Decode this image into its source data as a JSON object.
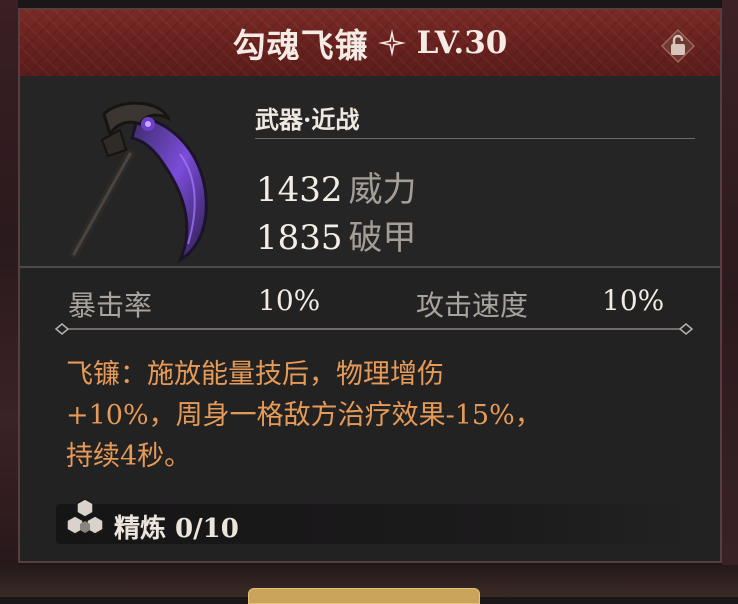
{
  "item": {
    "name": "勾魂飞镰",
    "level": "LV.30",
    "category": "武器·近战"
  },
  "stats": [
    {
      "value": "1432",
      "name": "威力"
    },
    {
      "value": "1835",
      "name": "破甲"
    }
  ],
  "secondary": [
    {
      "label": "暴击率",
      "value": "10%"
    },
    {
      "label": "攻击速度",
      "value": "10%"
    }
  ],
  "description": {
    "line1": "飞镰：施放能量技后，物理增伤",
    "line2": "+10%，周身一格敌方治疗效果-15%，",
    "line3": "持续4秒。"
  },
  "refine": {
    "label": "精炼 0/10"
  },
  "colors": {
    "header": "#6a221f",
    "panel": "#232223",
    "description": "#e59a57",
    "text_light": "#efe8e0",
    "text_muted": "#a59e97"
  },
  "icons": [
    "star-icon",
    "lock-icon",
    "weapon-scythe-icon",
    "refine-hexagon-icon"
  ]
}
